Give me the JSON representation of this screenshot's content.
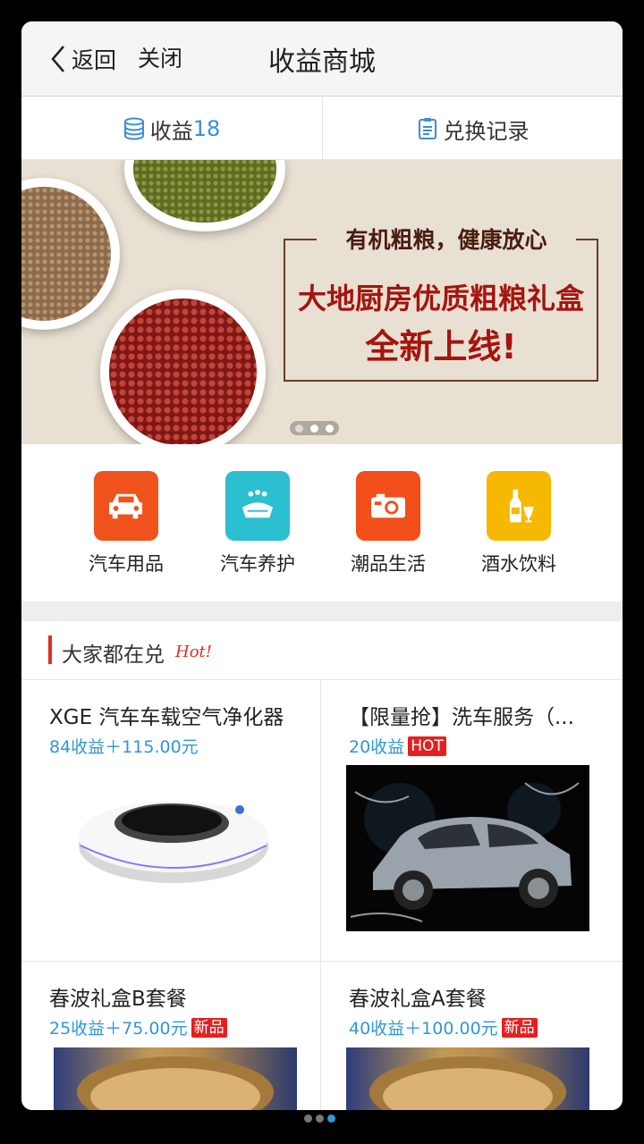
{
  "header": {
    "back_label": "返回",
    "close_label": "关闭",
    "title": "收益商城"
  },
  "topbar": {
    "earnings_label": "收益",
    "earnings_value": "18",
    "records_label": "兑换记录"
  },
  "banner": {
    "line_top": "有机粗粮，健康放心",
    "line_1": "大地厨房优质粗粮礼盒",
    "line_2": "全新上线!",
    "page_count": 3,
    "active_page": 1
  },
  "categories": [
    {
      "label": "汽车用品",
      "icon": "car-icon",
      "color": "#f0521c"
    },
    {
      "label": "汽车养护",
      "icon": "car-wash-icon",
      "color": "#2bbfd0"
    },
    {
      "label": "潮品生活",
      "icon": "camera-icon",
      "color": "#f24f1b"
    },
    {
      "label": "酒水饮料",
      "icon": "wine-bottle-icon",
      "color": "#f6b800"
    }
  ],
  "section": {
    "title": "大家都在兑",
    "hot_tag": "Hot!"
  },
  "products": [
    {
      "name": "XGE 汽车车载空气净化器",
      "price": "84收益＋115.00元",
      "badge": "",
      "image": "air-purifier"
    },
    {
      "name": "【限量抢】洗车服务（...",
      "price": "20收益",
      "badge": "HOT",
      "image": "car-splash"
    },
    {
      "name": "春波礼盒B套餐",
      "price": "25收益＋75.00元",
      "badge": "新品",
      "image": "grain-bowl"
    },
    {
      "name": "春波礼盒A套餐",
      "price": "40收益＋100.00元",
      "badge": "新品",
      "image": "grain-bowl"
    }
  ],
  "colors": {
    "accent": "#3b8fd6",
    "hot": "#e02e24",
    "price": "#2f97d9"
  }
}
